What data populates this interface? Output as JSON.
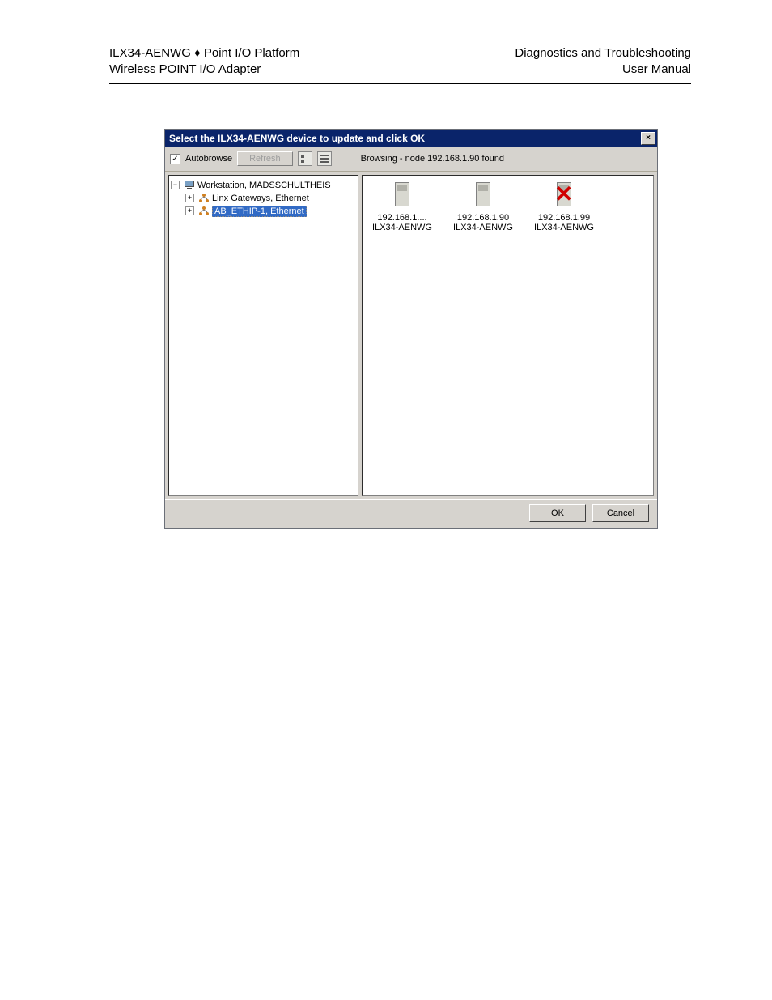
{
  "header": {
    "left_line1_a": "ILX34-AENWG",
    "left_line1_sep": "♦",
    "left_line1_b": "Point I/O Platform",
    "left_line2": "Wireless POINT I/O Adapter",
    "right_line1": "Diagnostics and Troubleshooting",
    "right_line2": "User Manual"
  },
  "dialog": {
    "title": "Select the ILX34-AENWG device to update and click OK",
    "close_glyph": "×",
    "autobrowse_label": "Autobrowse",
    "autobrowse_checked": "✓",
    "refresh_label": "Refresh",
    "status": "Browsing - node 192.168.1.90 found",
    "ok_label": "OK",
    "cancel_label": "Cancel"
  },
  "tree": {
    "root": "Workstation, MADSSCHULTHEIS",
    "child1": "Linx Gateways, Ethernet",
    "child2": "AB_ETHIP-1, Ethernet"
  },
  "devices": [
    {
      "ip": "192.168.1....",
      "name": "ILX34-AENWG",
      "error": false
    },
    {
      "ip": "192.168.1.90",
      "name": "ILX34-AENWG",
      "error": false
    },
    {
      "ip": "192.168.1.99",
      "name": "ILX34-AENWG",
      "error": true
    }
  ]
}
